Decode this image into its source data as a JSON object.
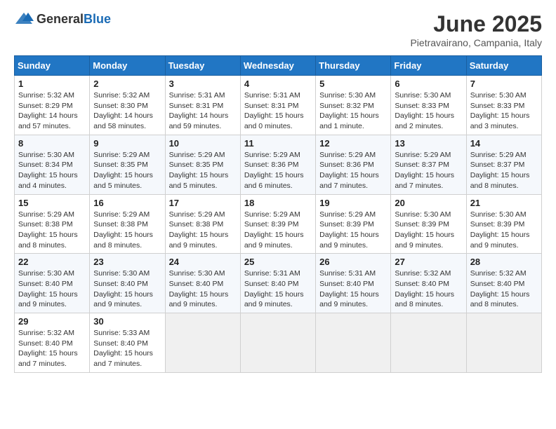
{
  "header": {
    "logo_general": "General",
    "logo_blue": "Blue",
    "title": "June 2025",
    "subtitle": "Pietravairano, Campania, Italy"
  },
  "weekdays": [
    "Sunday",
    "Monday",
    "Tuesday",
    "Wednesday",
    "Thursday",
    "Friday",
    "Saturday"
  ],
  "weeks": [
    [
      {
        "day": "1",
        "info": "Sunrise: 5:32 AM\nSunset: 8:29 PM\nDaylight: 14 hours\nand 57 minutes."
      },
      {
        "day": "2",
        "info": "Sunrise: 5:32 AM\nSunset: 8:30 PM\nDaylight: 14 hours\nand 58 minutes."
      },
      {
        "day": "3",
        "info": "Sunrise: 5:31 AM\nSunset: 8:31 PM\nDaylight: 14 hours\nand 59 minutes."
      },
      {
        "day": "4",
        "info": "Sunrise: 5:31 AM\nSunset: 8:31 PM\nDaylight: 15 hours\nand 0 minutes."
      },
      {
        "day": "5",
        "info": "Sunrise: 5:30 AM\nSunset: 8:32 PM\nDaylight: 15 hours\nand 1 minute."
      },
      {
        "day": "6",
        "info": "Sunrise: 5:30 AM\nSunset: 8:33 PM\nDaylight: 15 hours\nand 2 minutes."
      },
      {
        "day": "7",
        "info": "Sunrise: 5:30 AM\nSunset: 8:33 PM\nDaylight: 15 hours\nand 3 minutes."
      }
    ],
    [
      {
        "day": "8",
        "info": "Sunrise: 5:30 AM\nSunset: 8:34 PM\nDaylight: 15 hours\nand 4 minutes."
      },
      {
        "day": "9",
        "info": "Sunrise: 5:29 AM\nSunset: 8:35 PM\nDaylight: 15 hours\nand 5 minutes."
      },
      {
        "day": "10",
        "info": "Sunrise: 5:29 AM\nSunset: 8:35 PM\nDaylight: 15 hours\nand 5 minutes."
      },
      {
        "day": "11",
        "info": "Sunrise: 5:29 AM\nSunset: 8:36 PM\nDaylight: 15 hours\nand 6 minutes."
      },
      {
        "day": "12",
        "info": "Sunrise: 5:29 AM\nSunset: 8:36 PM\nDaylight: 15 hours\nand 7 minutes."
      },
      {
        "day": "13",
        "info": "Sunrise: 5:29 AM\nSunset: 8:37 PM\nDaylight: 15 hours\nand 7 minutes."
      },
      {
        "day": "14",
        "info": "Sunrise: 5:29 AM\nSunset: 8:37 PM\nDaylight: 15 hours\nand 8 minutes."
      }
    ],
    [
      {
        "day": "15",
        "info": "Sunrise: 5:29 AM\nSunset: 8:38 PM\nDaylight: 15 hours\nand 8 minutes."
      },
      {
        "day": "16",
        "info": "Sunrise: 5:29 AM\nSunset: 8:38 PM\nDaylight: 15 hours\nand 8 minutes."
      },
      {
        "day": "17",
        "info": "Sunrise: 5:29 AM\nSunset: 8:38 PM\nDaylight: 15 hours\nand 9 minutes."
      },
      {
        "day": "18",
        "info": "Sunrise: 5:29 AM\nSunset: 8:39 PM\nDaylight: 15 hours\nand 9 minutes."
      },
      {
        "day": "19",
        "info": "Sunrise: 5:29 AM\nSunset: 8:39 PM\nDaylight: 15 hours\nand 9 minutes."
      },
      {
        "day": "20",
        "info": "Sunrise: 5:30 AM\nSunset: 8:39 PM\nDaylight: 15 hours\nand 9 minutes."
      },
      {
        "day": "21",
        "info": "Sunrise: 5:30 AM\nSunset: 8:39 PM\nDaylight: 15 hours\nand 9 minutes."
      }
    ],
    [
      {
        "day": "22",
        "info": "Sunrise: 5:30 AM\nSunset: 8:40 PM\nDaylight: 15 hours\nand 9 minutes."
      },
      {
        "day": "23",
        "info": "Sunrise: 5:30 AM\nSunset: 8:40 PM\nDaylight: 15 hours\nand 9 minutes."
      },
      {
        "day": "24",
        "info": "Sunrise: 5:30 AM\nSunset: 8:40 PM\nDaylight: 15 hours\nand 9 minutes."
      },
      {
        "day": "25",
        "info": "Sunrise: 5:31 AM\nSunset: 8:40 PM\nDaylight: 15 hours\nand 9 minutes."
      },
      {
        "day": "26",
        "info": "Sunrise: 5:31 AM\nSunset: 8:40 PM\nDaylight: 15 hours\nand 9 minutes."
      },
      {
        "day": "27",
        "info": "Sunrise: 5:32 AM\nSunset: 8:40 PM\nDaylight: 15 hours\nand 8 minutes."
      },
      {
        "day": "28",
        "info": "Sunrise: 5:32 AM\nSunset: 8:40 PM\nDaylight: 15 hours\nand 8 minutes."
      }
    ],
    [
      {
        "day": "29",
        "info": "Sunrise: 5:32 AM\nSunset: 8:40 PM\nDaylight: 15 hours\nand 7 minutes."
      },
      {
        "day": "30",
        "info": "Sunrise: 5:33 AM\nSunset: 8:40 PM\nDaylight: 15 hours\nand 7 minutes."
      },
      null,
      null,
      null,
      null,
      null
    ]
  ]
}
